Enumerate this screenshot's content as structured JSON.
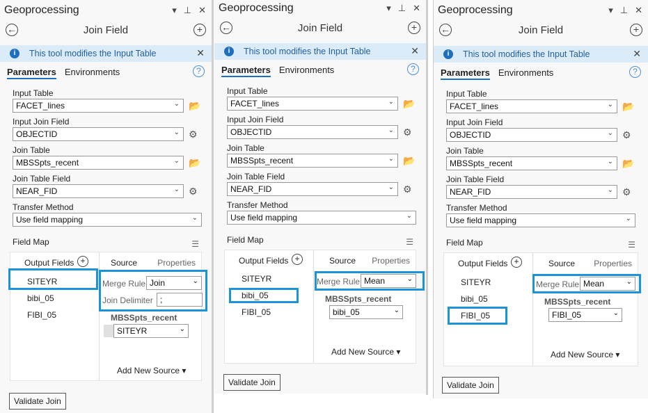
{
  "panels": [
    {
      "header": "Geoprocessing",
      "title": "Join Field",
      "info": "This tool modifies the Input Table",
      "tabs": [
        "Parameters",
        "Environments"
      ],
      "input_table_label": "Input Table",
      "input_table": "FACET_lines",
      "input_join_field_label": "Input Join Field",
      "input_join_field": "OBJECTID",
      "join_table_label": "Join Table",
      "join_table": "MBSSpts_recent",
      "join_table_field_label": "Join Table Field",
      "join_table_field": "NEAR_FID",
      "transfer_method_label": "Transfer Method",
      "transfer_method": "Use field mapping",
      "field_map_label": "Field Map",
      "output_fields_label": "Output Fields",
      "fields": [
        "SITEYR",
        "bibi_05",
        "FIBI_05"
      ],
      "source_label": "Source",
      "properties_label": "Properties",
      "merge_rule_label": "Merge Rule",
      "merge_rule": "Join",
      "join_delimiter_label": "Join Delimiter",
      "join_delimiter": ";",
      "source_table": "MBSSpts_recent",
      "source_field": "SITEYR",
      "add_new_source": "Add New Source",
      "validate": "Validate Join"
    },
    {
      "header": "Geoprocessing",
      "title": "Join Field",
      "info": "This tool modifies the Input Table",
      "tabs": [
        "Parameters",
        "Environments"
      ],
      "input_table_label": "Input Table",
      "input_table": "FACET_lines",
      "input_join_field_label": "Input Join Field",
      "input_join_field": "OBJECTID",
      "join_table_label": "Join Table",
      "join_table": "MBSSpts_recent",
      "join_table_field_label": "Join Table Field",
      "join_table_field": "NEAR_FID",
      "transfer_method_label": "Transfer Method",
      "transfer_method": "Use field mapping",
      "field_map_label": "Field Map",
      "output_fields_label": "Output Fields",
      "fields": [
        "SITEYR",
        "bibi_05",
        "FIBI_05"
      ],
      "source_label": "Source",
      "properties_label": "Properties",
      "merge_rule_label": "Merge Rule",
      "merge_rule": "Mean",
      "source_table": "MBSSpts_recent",
      "source_field": "bibi_05",
      "add_new_source": "Add New Source",
      "validate": "Validate Join"
    },
    {
      "header": "Geoprocessing",
      "title": "Join Field",
      "info": "This tool modifies the Input Table",
      "tabs": [
        "Parameters",
        "Environments"
      ],
      "input_table_label": "Input Table",
      "input_table": "FACET_lines",
      "input_join_field_label": "Input Join Field",
      "input_join_field": "OBJECTID",
      "join_table_label": "Join Table",
      "join_table": "MBSSpts_recent",
      "join_table_field_label": "Join Table Field",
      "join_table_field": "NEAR_FID",
      "transfer_method_label": "Transfer Method",
      "transfer_method": "Use field mapping",
      "field_map_label": "Field Map",
      "output_fields_label": "Output Fields",
      "fields": [
        "SITEYR",
        "bibi_05",
        "FIBI_05"
      ],
      "source_label": "Source",
      "properties_label": "Properties",
      "merge_rule_label": "Merge Rule",
      "merge_rule": "Mean",
      "source_table": "MBSSpts_recent",
      "source_field": "FIBI_05",
      "add_new_source": "Add New Source",
      "validate": "Validate Join"
    }
  ],
  "colors": {
    "highlight": "#1b93d6",
    "info_bg": "#dcebf8",
    "accent": "#1f6fbf"
  }
}
